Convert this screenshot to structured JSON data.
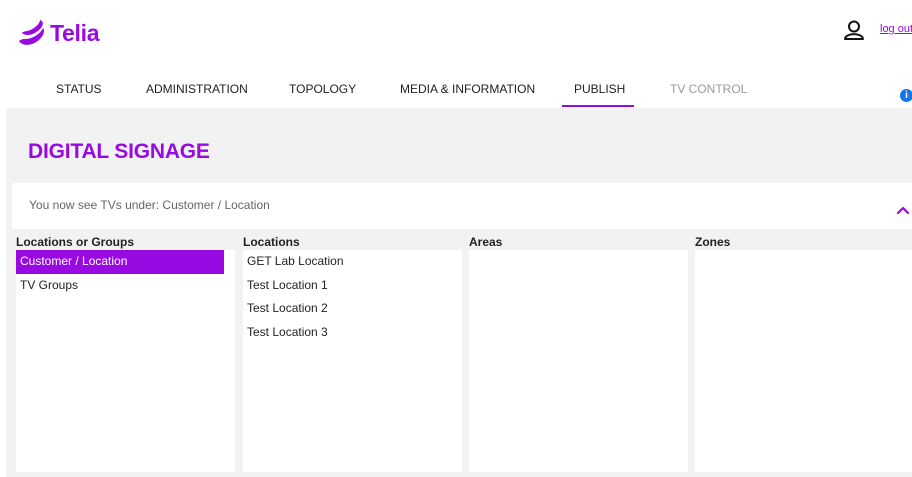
{
  "brand": {
    "name": "Telia",
    "color": "#990ae3"
  },
  "header": {
    "user_icon": "user-icon",
    "logout_label": "log out"
  },
  "nav": {
    "items": [
      {
        "label": "STATUS",
        "active": false,
        "disabled": false
      },
      {
        "label": "ADMINISTRATION",
        "active": false,
        "disabled": false
      },
      {
        "label": "TOPOLOGY",
        "active": false,
        "disabled": false
      },
      {
        "label": "MEDIA & INFORMATION",
        "active": false,
        "disabled": false
      },
      {
        "label": "PUBLISH",
        "active": true,
        "disabled": false
      },
      {
        "label": "TV CONTROL",
        "active": false,
        "disabled": true
      }
    ],
    "info_icon": "info-icon",
    "info_glyph": "i"
  },
  "page": {
    "title": "DIGITAL SIGNAGE",
    "notice": "You now see TVs under: Customer / Location"
  },
  "columns": [
    {
      "header": "Locations or Groups",
      "items": [
        "Customer / Location",
        "TV Groups"
      ],
      "selected_index": 0
    },
    {
      "header": "Locations",
      "items": [
        "GET Lab Location",
        "Test Location 1",
        "Test Location 2",
        "Test Location 3"
      ],
      "selected_index": -1
    },
    {
      "header": "Areas",
      "items": [],
      "selected_index": -1
    },
    {
      "header": "Zones",
      "items": [],
      "selected_index": -1
    }
  ]
}
